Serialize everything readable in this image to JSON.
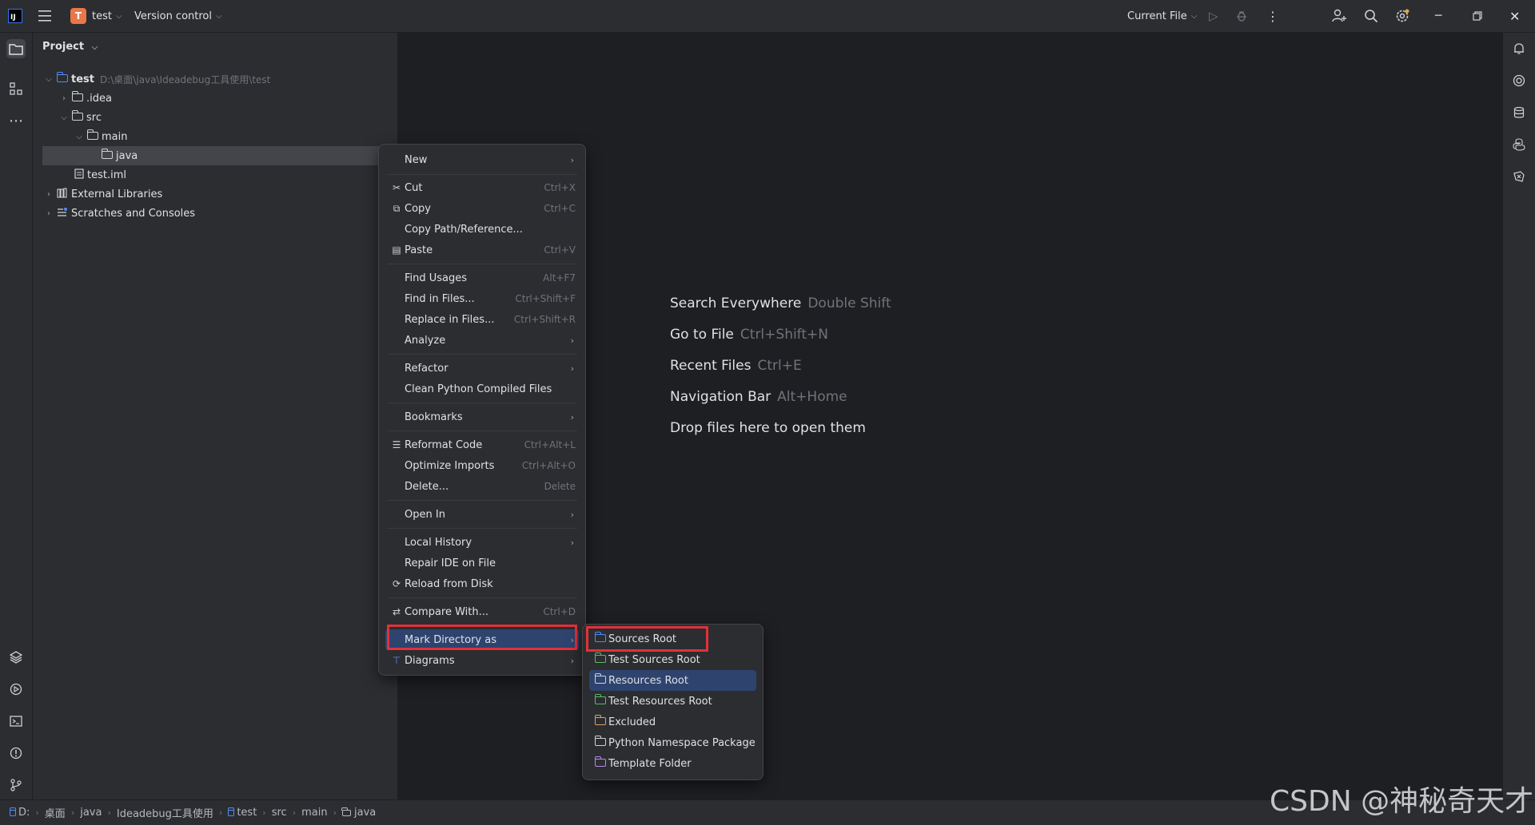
{
  "titlebar": {
    "app_logo": "IJ",
    "project_initial": "T",
    "project_name": "test",
    "vcs_label": "Version control",
    "run_config": "Current File"
  },
  "project_pane": {
    "title": "Project",
    "tree": [
      {
        "label": "test",
        "path": "D:\\桌面\\java\\Ideadebug工具使用\\test",
        "icon": "module-folder-icon",
        "expanded": true
      },
      {
        "label": ".idea",
        "icon": "folder-icon",
        "expanded": false
      },
      {
        "label": "src",
        "icon": "folder-icon",
        "expanded": true
      },
      {
        "label": "main",
        "icon": "folder-icon",
        "expanded": true
      },
      {
        "label": "java",
        "icon": "folder-icon",
        "selected": true
      },
      {
        "label": "test.iml",
        "icon": "file-icon"
      },
      {
        "label": "External Libraries",
        "icon": "library-icon",
        "expanded": false
      },
      {
        "label": "Scratches and Consoles",
        "icon": "scratches-icon",
        "expanded": false
      }
    ]
  },
  "editor_hints": [
    {
      "label": "Search Everywhere",
      "shortcut": "Double Shift"
    },
    {
      "label": "Go to File",
      "shortcut": "Ctrl+Shift+N"
    },
    {
      "label": "Recent Files",
      "shortcut": "Ctrl+E"
    },
    {
      "label": "Navigation Bar",
      "shortcut": "Alt+Home"
    },
    {
      "label": "Drop files here to open them",
      "shortcut": ""
    }
  ],
  "context_menu": {
    "items": [
      {
        "label": "New",
        "shortcut": "",
        "submenu": true,
        "icon": ""
      },
      {
        "label": "Cut",
        "shortcut": "Ctrl+X",
        "icon": "scissors-icon"
      },
      {
        "label": "Copy",
        "shortcut": "Ctrl+C",
        "icon": "copy-icon"
      },
      {
        "label": "Copy Path/Reference...",
        "shortcut": ""
      },
      {
        "label": "Paste",
        "shortcut": "Ctrl+V",
        "icon": "paste-icon"
      },
      {
        "label": "Find Usages",
        "shortcut": "Alt+F7"
      },
      {
        "label": "Find in Files...",
        "shortcut": "Ctrl+Shift+F"
      },
      {
        "label": "Replace in Files...",
        "shortcut": "Ctrl+Shift+R"
      },
      {
        "label": "Analyze",
        "shortcut": "",
        "submenu": true
      },
      {
        "label": "Refactor",
        "shortcut": "",
        "submenu": true
      },
      {
        "label": "Clean Python Compiled Files",
        "shortcut": ""
      },
      {
        "label": "Bookmarks",
        "shortcut": "",
        "submenu": true
      },
      {
        "label": "Reformat Code",
        "shortcut": "Ctrl+Alt+L",
        "icon": "reformat-icon"
      },
      {
        "label": "Optimize Imports",
        "shortcut": "Ctrl+Alt+O"
      },
      {
        "label": "Delete...",
        "shortcut": "Delete"
      },
      {
        "label": "Open In",
        "shortcut": "",
        "submenu": true
      },
      {
        "label": "Local History",
        "shortcut": "",
        "submenu": true
      },
      {
        "label": "Repair IDE on File",
        "shortcut": ""
      },
      {
        "label": "Reload from Disk",
        "shortcut": "",
        "icon": "reload-icon"
      },
      {
        "label": "Compare With...",
        "shortcut": "Ctrl+D",
        "icon": "compare-icon"
      },
      {
        "label": "Mark Directory as",
        "shortcut": "",
        "submenu": true,
        "highlighted": true
      },
      {
        "label": "Diagrams",
        "shortcut": "",
        "submenu": true,
        "icon": "diagram-icon"
      }
    ]
  },
  "submenu": {
    "items": [
      {
        "label": "Sources Root",
        "color": "#548af7"
      },
      {
        "label": "Test Sources Root",
        "color": "#5fb865"
      },
      {
        "label": "Resources Root",
        "color": "#ced0d6",
        "highlighted": true
      },
      {
        "label": "Test Resources Root",
        "color": "#5fb865"
      },
      {
        "label": "Excluded",
        "color": "#e0a060"
      },
      {
        "label": "Python Namespace Package",
        "color": "#ced0d6"
      },
      {
        "label": "Template Folder",
        "color": "#b78ae8"
      }
    ]
  },
  "statusbar": {
    "crumbs": [
      "D:",
      "桌面",
      "java",
      "Ideadebug工具使用",
      "test",
      "src",
      "main",
      "java"
    ]
  },
  "watermark": "CSDN @神秘奇天才"
}
